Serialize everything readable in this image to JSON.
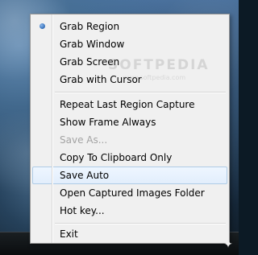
{
  "menu": {
    "items": [
      {
        "label": "Grab Region",
        "selected": true,
        "disabled": false
      },
      {
        "label": "Grab Window",
        "selected": false,
        "disabled": false
      },
      {
        "label": "Grab Screen",
        "selected": false,
        "disabled": false
      },
      {
        "label": "Grab with Cursor",
        "selected": false,
        "disabled": false
      },
      {
        "label": "Repeat Last Region Capture",
        "selected": false,
        "disabled": false
      },
      {
        "label": "Show Frame Always",
        "selected": false,
        "disabled": false
      },
      {
        "label": "Save As...",
        "selected": false,
        "disabled": true
      },
      {
        "label": "Copy To Clipboard Only",
        "selected": false,
        "disabled": false
      },
      {
        "label": "Save Auto",
        "selected": false,
        "disabled": false,
        "highlighted": true
      },
      {
        "label": "Open Captured Images Folder",
        "selected": false,
        "disabled": false
      },
      {
        "label": "Hot key...",
        "selected": false,
        "disabled": false
      },
      {
        "label": "Exit",
        "selected": false,
        "disabled": false
      }
    ]
  },
  "watermark": {
    "main": "SOFTPEDIA",
    "sub": "www.softpedia.com"
  },
  "taskbar": {
    "icon_name": "capture-app-icon",
    "icon_glyph": "✦"
  },
  "colors": {
    "menu_background": "#f0f0f0",
    "menu_border": "#979797",
    "highlight_fill": "#e2eefc",
    "highlight_border": "#aecbe6",
    "disabled_text": "#a3a3a3",
    "radio_blue": "#3f78c0"
  }
}
